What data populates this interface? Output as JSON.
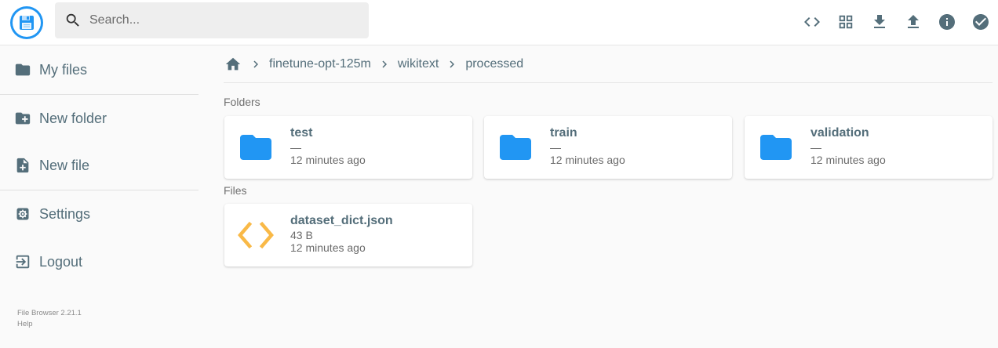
{
  "app": {
    "logo": "floppy-disk-logo"
  },
  "search": {
    "placeholder": "Search..."
  },
  "header_actions": [
    {
      "name": "code-icon"
    },
    {
      "name": "grid-view-icon"
    },
    {
      "name": "download-icon"
    },
    {
      "name": "upload-icon"
    },
    {
      "name": "info-icon"
    },
    {
      "name": "select-check-icon"
    }
  ],
  "sidebar": {
    "items": [
      {
        "label": "My files",
        "icon": "folder-icon"
      },
      {
        "label": "New folder",
        "icon": "create-new-folder-icon"
      },
      {
        "label": "New file",
        "icon": "note-add-icon"
      },
      {
        "label": "Settings",
        "icon": "settings-icon"
      },
      {
        "label": "Logout",
        "icon": "logout-icon"
      }
    ],
    "version": "File Browser 2.21.1",
    "help": "Help"
  },
  "breadcrumbs": {
    "home_icon": "home-icon",
    "parts": [
      "finetune-opt-125m",
      "wikitext",
      "processed"
    ]
  },
  "sections": {
    "folders": "Folders",
    "files": "Files"
  },
  "folders": [
    {
      "name": "test",
      "size": "—",
      "modified": "12 minutes ago"
    },
    {
      "name": "train",
      "size": "—",
      "modified": "12 minutes ago"
    },
    {
      "name": "validation",
      "size": "—",
      "modified": "12 minutes ago"
    }
  ],
  "files": [
    {
      "name": "dataset_dict.json",
      "size": "43 B",
      "modified": "12 minutes ago",
      "icon": "code-file-icon"
    }
  ],
  "colors": {
    "accent": "#2196f3",
    "text": "#546e7a",
    "file_icon": "#f9b947",
    "folder_icon": "#2196f3"
  }
}
